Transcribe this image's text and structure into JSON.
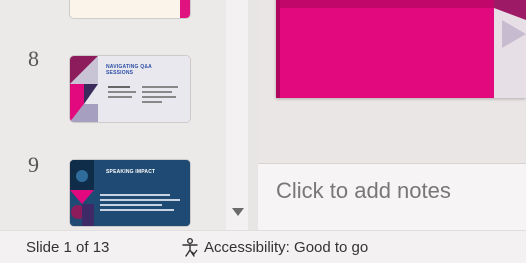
{
  "thumbnails": [
    {
      "number": "",
      "title": ""
    },
    {
      "number": "8",
      "title": "NAVIGATING Q&A SESSIONS"
    },
    {
      "number": "9",
      "title": "SPEAKING IMPACT"
    }
  ],
  "notes": {
    "placeholder": "Click to add notes"
  },
  "status": {
    "slide_indicator": "Slide 1 of 13",
    "accessibility": "Accessibility: Good to go"
  },
  "colors": {
    "accent": "#e2087e",
    "thumb9_bg": "#1f4a73"
  },
  "icons": {
    "scroll": "triangle-down-icon",
    "accessibility": "accessibility-figure-icon"
  }
}
